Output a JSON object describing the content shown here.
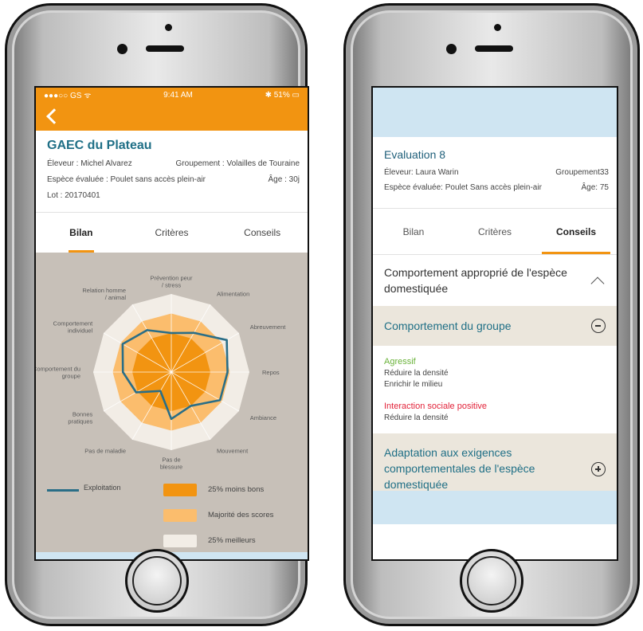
{
  "left_phone": {
    "status_bar": {
      "carrier": "●●●○○ GS ᯤ",
      "time": "9:41 AM",
      "battery": "✱ 51% ▭"
    },
    "farm": {
      "title": "GAEC du Plateau",
      "eleveur": "Éleveur : Michel Alvarez",
      "groupement": "Groupement : Volailles de Touraine",
      "espece": "Espèce évaluée : Poulet sans accès plein-air",
      "age": "Âge : 30j",
      "lot": "Lot : 20170401"
    },
    "tabs": [
      "Bilan",
      "Critères",
      "Conseils"
    ],
    "active_tab": "Bilan",
    "legend": {
      "line": "Exploitation",
      "worst": "25% moins bons",
      "majority": "Majorité des scores",
      "best": "25% meilleurs"
    },
    "colors": {
      "accent": "#f29411",
      "worst": "#f29411",
      "majority": "#fbbd6d",
      "best": "#f2ede6",
      "line": "#2a6e87",
      "background": "#c7c0b8"
    }
  },
  "chart_data": {
    "type": "radar",
    "axes": [
      "Prévention peur / stress",
      "Alimentation",
      "Abreuvement",
      "Repos",
      "Ambiance",
      "Mouvement",
      "Pas de blessure",
      "Pas de maladie",
      "Bonnes pratiques",
      "Comportement du groupe",
      "Comportement individuel",
      "Relation homme / animal"
    ],
    "series": [
      {
        "name": "25% meilleurs",
        "values": [
          100,
          100,
          100,
          100,
          100,
          100,
          100,
          100,
          100,
          100,
          100,
          100
        ]
      },
      {
        "name": "Majorité des scores",
        "values": [
          75,
          75,
          75,
          75,
          75,
          75,
          75,
          75,
          75,
          75,
          75,
          75
        ]
      },
      {
        "name": "25% moins bons",
        "values": [
          50,
          50,
          50,
          50,
          50,
          50,
          50,
          50,
          50,
          50,
          50,
          50
        ]
      },
      {
        "name": "Exploitation",
        "values": [
          50,
          58,
          82,
          72,
          72,
          50,
          60,
          28,
          52,
          62,
          72,
          62
        ]
      }
    ],
    "ylim": [
      0,
      100
    ]
  },
  "right_phone": {
    "evaluation": {
      "title": "Evaluation 8",
      "eleveur": "Éleveur: Laura Warin",
      "groupement": "Groupement33",
      "espece": "Espèce évaluée: Poulet Sans accès plein-air",
      "age": "Âge: 75"
    },
    "tabs": [
      "Bilan",
      "Critères",
      "Conseils"
    ],
    "active_tab": "Conseils",
    "section_title": "Comportement approprié de l'espèce domestiquée",
    "group": {
      "title": "Comportement du groupe",
      "advice": [
        {
          "label": "Agressif",
          "color": "#6bb33b",
          "lines": [
            "Réduire la densité",
            "Enrichir le milieu"
          ]
        },
        {
          "label": "Interaction sociale positive",
          "color": "#e2233a",
          "lines": [
            "Réduire la densité"
          ]
        }
      ]
    },
    "adaptation": {
      "title": "Adaptation aux exigences comportementales de l'espèce domestiquée"
    }
  }
}
